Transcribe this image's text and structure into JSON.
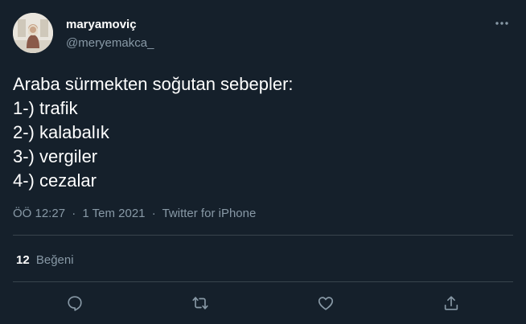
{
  "author": {
    "display_name": "maryamoviç",
    "handle": "@meryemakca_"
  },
  "tweet": {
    "lines": [
      "Araba sürmekten soğutan sebepler:",
      "1-) trafik",
      "2-) kalabalık",
      "3-) vergiler",
      "4-) cezalar"
    ]
  },
  "meta": {
    "time": "ÖÖ 12:27",
    "separator": "·",
    "date": "1 Tem 2021",
    "source": "Twitter for iPhone"
  },
  "stats": {
    "likes_count": "12",
    "likes_label": "Beğeni"
  },
  "icons": {
    "more": "more-horizontal-icon",
    "reply": "reply-icon",
    "retweet": "retweet-icon",
    "like": "heart-icon",
    "share": "share-icon"
  },
  "colors": {
    "background": "#15202b",
    "text": "#ffffff",
    "secondary_text": "#8899a6",
    "divider": "#38444d"
  }
}
